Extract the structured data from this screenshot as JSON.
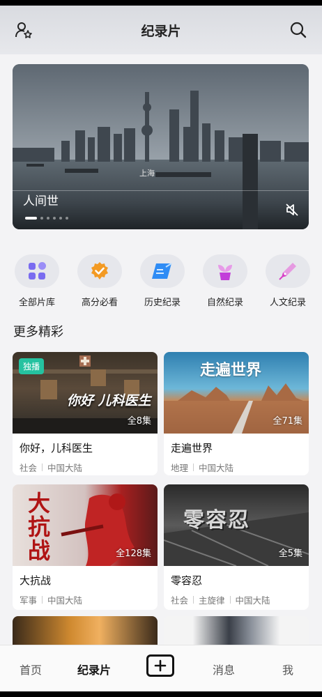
{
  "header": {
    "title": "纪录片",
    "left_icon": "user-star-icon",
    "right_icon": "search-icon"
  },
  "hero": {
    "title": "人间世",
    "overlay_text": "上海",
    "slide_index": 1,
    "slide_count": 6,
    "mute_icon": "mute-icon"
  },
  "categories": [
    {
      "label": "全部片库",
      "icon": "grid-icon",
      "color": "#7a6cf0"
    },
    {
      "label": "高分必看",
      "icon": "badge-check-icon",
      "color": "#f39a23"
    },
    {
      "label": "历史纪录",
      "icon": "scroll-icon",
      "color": "#2f8cf5"
    },
    {
      "label": "自然纪录",
      "icon": "plant-icon",
      "color": "#c23fd9"
    },
    {
      "label": "人文纪录",
      "icon": "pen-icon",
      "color": "#d73fc6"
    }
  ],
  "section": {
    "title": "更多精彩"
  },
  "cards": [
    {
      "name": "你好，儿科医生",
      "tags": [
        "社会",
        "中国大陆"
      ],
      "episodes": "全8集",
      "exclusive": "独播",
      "thumb_text": "你好 儿科医生"
    },
    {
      "name": "走遍世界",
      "tags": [
        "地理",
        "中国大陆"
      ],
      "episodes": "全71集",
      "thumb_text": "走遍世界"
    },
    {
      "name": "大抗战",
      "tags": [
        "军事",
        "中国大陆"
      ],
      "episodes": "全128集",
      "thumb_text": "大抗战"
    },
    {
      "name": "零容忍",
      "tags": [
        "社会",
        "主旋律",
        "中国大陆"
      ],
      "episodes": "全5集",
      "thumb_text": "零容忍"
    }
  ],
  "nav": {
    "items": [
      "首页",
      "纪录片",
      "消息",
      "我"
    ],
    "active": "纪录片",
    "plus_icon": "plus-icon"
  }
}
